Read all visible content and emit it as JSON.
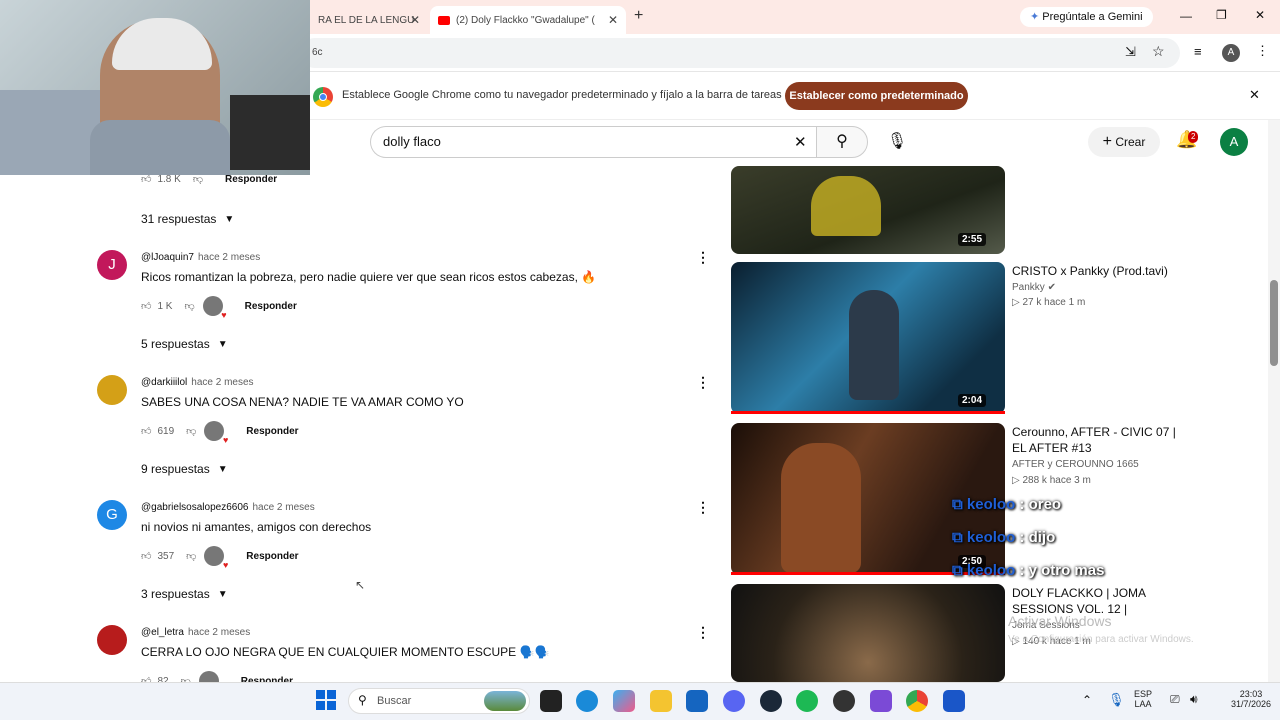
{
  "browser": {
    "tabs": [
      {
        "title": "RA EL DE LA LENGU"
      },
      {
        "title": "(2) Doly Flackko \"Gwadalupe\" ("
      }
    ],
    "new_tab": "+",
    "gemini": "Pregúntale a Gemini",
    "address": "6c",
    "infobar": {
      "message": "Establece Google Chrome como tu navegador predeterminado y fíjalo a la barra de tareas",
      "button": "Establecer como predeterminado",
      "close": "✕"
    },
    "profile_initial": "A"
  },
  "youtube": {
    "search_value": "dolly flaco",
    "create_label": "Crear",
    "notifications": "2",
    "avatar_initial": "A"
  },
  "comments": {
    "top_actions": {
      "likes": "1.8 K",
      "reply": "Responder"
    },
    "top_replies": "31 respuestas",
    "items": [
      {
        "handle": "@lJoaquin7",
        "age": "hace 2 meses",
        "text": "Ricos romantizan la pobreza, pero nadie quiere ver que sean ricos estos cabezas, 🔥",
        "likes": "1 K",
        "reply": "Responder",
        "replies": "5 respuestas",
        "avatar": "J",
        "avatar_color": "#c2185b"
      },
      {
        "handle": "@darkiiilol",
        "age": "hace 2 meses",
        "text": "SABES UNA COSA NENA? NADIE TE VA AMAR COMO YO",
        "likes": "619",
        "reply": "Responder",
        "replies": "9 respuestas",
        "avatar": "",
        "avatar_color": "#d4a017"
      },
      {
        "handle": "@gabrielsosalopez6606",
        "age": "hace 2 meses",
        "text": "ni novios ni amantes, amigos con derechos",
        "likes": "357",
        "reply": "Responder",
        "replies": "3 respuestas",
        "avatar": "G",
        "avatar_color": "#1e88e5"
      },
      {
        "handle": "@el_letra",
        "age": "hace 2 meses",
        "text": "CERRA LO OJO NEGRA QUE EN CUALQUIER MOMENTO ESCUPE 🗣️🗣️",
        "likes": "82",
        "reply": "Responder",
        "replies": "",
        "avatar": "",
        "avatar_color": "#b71c1c"
      }
    ]
  },
  "related": [
    {
      "title": "",
      "channel": "",
      "meta": "",
      "duration": "2:55"
    },
    {
      "title": "CRISTO x Pankky (Prod.tavi)",
      "channel": "Pankky",
      "meta": "▷ 27 k  hace 1 m",
      "duration": "2:04"
    },
    {
      "title": "Cerounno, AFTER - CIVIC 07 | EL AFTER #13",
      "channel": "AFTER  y CEROUNNO 1665",
      "meta": "▷ 288 k  hace 3 m",
      "duration": "2:50"
    },
    {
      "title": "DOLY FLACKKO | JOMA SESSIONS VOL. 12 |",
      "channel": "Joma Sessions",
      "meta": "▷ 140 k  hace 1 m",
      "duration": ""
    }
  ],
  "chat_overlay": [
    {
      "user": "keoloo",
      "msg": ": oreo"
    },
    {
      "user": "keoloo",
      "msg": ": dijo"
    },
    {
      "user": "keoloo",
      "msg": ": y otro mas"
    }
  ],
  "windows_watermark": {
    "title": "Activar Windows",
    "subtitle": "Ve a Configuración para activar Windows."
  },
  "taskbar": {
    "search_placeholder": "Buscar",
    "lang": "ESP",
    "lang2": "LAA",
    "time": "23:03",
    "date": "31/7/2026"
  }
}
